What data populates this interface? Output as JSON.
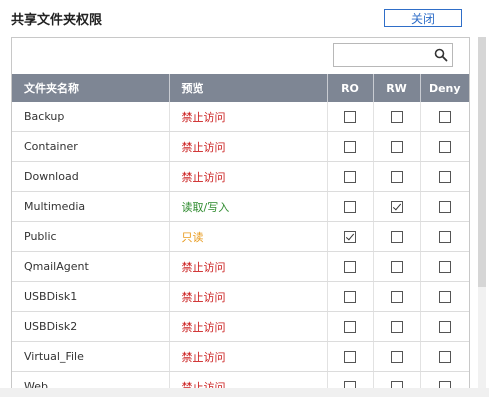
{
  "dialog": {
    "title": "共享文件夹权限",
    "close_label": "关闭"
  },
  "search": {
    "placeholder": "",
    "value": ""
  },
  "table": {
    "headers": {
      "name": "文件夹名称",
      "preview": "预览",
      "ro": "RO",
      "rw": "RW",
      "deny": "Deny"
    },
    "rows": [
      {
        "name": "Backup",
        "preview": "禁止访问",
        "preview_color": "#cc1f1f",
        "ro": false,
        "rw": false,
        "deny": false
      },
      {
        "name": "Container",
        "preview": "禁止访问",
        "preview_color": "#cc1f1f",
        "ro": false,
        "rw": false,
        "deny": false
      },
      {
        "name": "Download",
        "preview": "禁止访问",
        "preview_color": "#cc1f1f",
        "ro": false,
        "rw": false,
        "deny": false
      },
      {
        "name": "Multimedia",
        "preview": "读取/写入",
        "preview_color": "#2e8b2e",
        "ro": false,
        "rw": true,
        "deny": false
      },
      {
        "name": "Public",
        "preview": "只读",
        "preview_color": "#e89a1c",
        "ro": true,
        "rw": false,
        "deny": false
      },
      {
        "name": "QmailAgent",
        "preview": "禁止访问",
        "preview_color": "#cc1f1f",
        "ro": false,
        "rw": false,
        "deny": false
      },
      {
        "name": "USBDisk1",
        "preview": "禁止访问",
        "preview_color": "#cc1f1f",
        "ro": false,
        "rw": false,
        "deny": false
      },
      {
        "name": "USBDisk2",
        "preview": "禁止访问",
        "preview_color": "#cc1f1f",
        "ro": false,
        "rw": false,
        "deny": false
      },
      {
        "name": "Virtual_File",
        "preview": "禁止访问",
        "preview_color": "#cc1f1f",
        "ro": false,
        "rw": false,
        "deny": false
      },
      {
        "name": "Web",
        "preview": "禁止访问",
        "preview_color": "#cc1f1f",
        "ro": false,
        "rw": false,
        "deny": false
      }
    ]
  },
  "colors": {
    "accent": "#2f6ec8",
    "header_bg": "#7e8694"
  }
}
